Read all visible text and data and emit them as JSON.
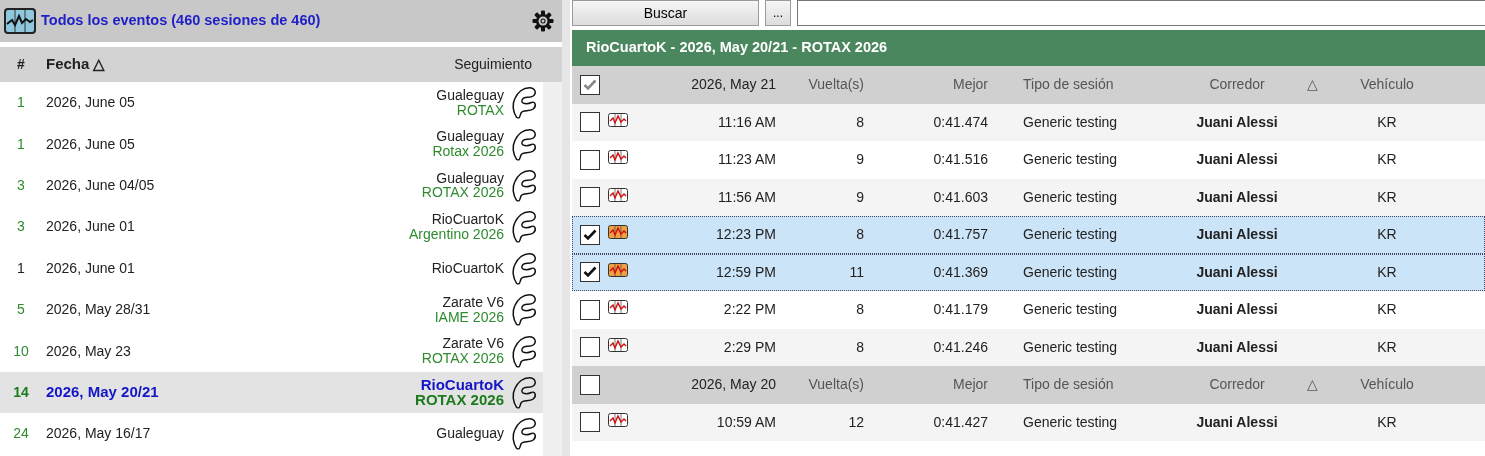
{
  "sidebar": {
    "title": "Todos los eventos (460 sesiones de 460)",
    "columns": [
      "#",
      "Fecha",
      "Seguimiento"
    ],
    "sort_mark": "△",
    "events": [
      {
        "count": "1",
        "date": "2026, June 05",
        "track": "Gualeguay",
        "series": "ROTAX",
        "color": "#2e8b2e",
        "selected": false
      },
      {
        "count": "1",
        "date": "2026, June 05",
        "track": "Gualeguay",
        "series": "Rotax 2026",
        "color": "#2e8b2e",
        "selected": false
      },
      {
        "count": "3",
        "date": "2026, June 04/05",
        "track": "Gualeguay",
        "series": "ROTAX 2026",
        "color": "#2e8b2e",
        "selected": false
      },
      {
        "count": "3",
        "date": "2026, June 01",
        "track": "RioCuartoK",
        "series": "Argentino 2026",
        "color": "#2e8b2e",
        "selected": false
      },
      {
        "count": "1",
        "date": "2026, June 01",
        "track": "RioCuartoK",
        "color": "#222222",
        "selected": false
      },
      {
        "count": "5",
        "date": "2026, May 28/31",
        "track": "Zarate V6",
        "series": "IAME 2026",
        "color": "#2e8b2e",
        "selected": false
      },
      {
        "count": "10",
        "date": "2026, May 23",
        "track": "Zarate V6",
        "series": "ROTAX 2026",
        "color": "#2e8b2e",
        "selected": false
      },
      {
        "count": "14",
        "date": "2026, May 20/21",
        "track": "RioCuartoK",
        "series": "ROTAX 2026",
        "color": "#1e7a1e",
        "selected": true
      },
      {
        "count": "24",
        "date": "2026, May 16/17",
        "track": "Gualeguay",
        "color": "#2e8b2e",
        "selected": false
      }
    ]
  },
  "search": {
    "button": "Buscar",
    "more_button": "..."
  },
  "event_title": "RioCuartoK - 2026, May 20/21 - ROTAX 2026",
  "groups": [
    {
      "date": "2026, May 21",
      "checked": true,
      "columns": [
        "Vuelta(s)",
        "Mejor",
        "Tipo de sesión",
        "Corredor",
        "Vehículo"
      ],
      "sort_mark": "△",
      "sessions": [
        {
          "time": "11:16 AM",
          "laps": "8",
          "best": "0:41.474",
          "type": "Generic testing",
          "driver": "Juani Alessi",
          "vehicle": "KR",
          "checked": false
        },
        {
          "time": "11:23 AM",
          "laps": "9",
          "best": "0:41.516",
          "type": "Generic testing",
          "driver": "Juani Alessi",
          "vehicle": "KR",
          "checked": false
        },
        {
          "time": "11:56 AM",
          "laps": "9",
          "best": "0:41.603",
          "type": "Generic testing",
          "driver": "Juani Alessi",
          "vehicle": "KR",
          "checked": false
        },
        {
          "time": "12:23 PM",
          "laps": "8",
          "best": "0:41.757",
          "type": "Generic testing",
          "driver": "Juani Alessi",
          "vehicle": "KR",
          "checked": true
        },
        {
          "time": "12:59 PM",
          "laps": "11",
          "best": "0:41.369",
          "type": "Generic testing",
          "driver": "Juani Alessi",
          "vehicle": "KR",
          "checked": true
        },
        {
          "time": "2:22 PM",
          "laps": "8",
          "best": "0:41.179",
          "type": "Generic testing",
          "driver": "Juani Alessi",
          "vehicle": "KR",
          "checked": false
        },
        {
          "time": "2:29 PM",
          "laps": "8",
          "best": "0:41.246",
          "type": "Generic testing",
          "driver": "Juani Alessi",
          "vehicle": "KR",
          "checked": false
        }
      ]
    },
    {
      "date": "2026, May 20",
      "checked": false,
      "columns": [
        "Vuelta(s)",
        "Mejor",
        "Tipo de sesión",
        "Corredor",
        "Vehículo"
      ],
      "sort_mark": "△",
      "sessions": [
        {
          "time": "10:59 AM",
          "laps": "12",
          "best": "0:41.427",
          "type": "Generic testing",
          "driver": "Juani Alessi",
          "vehicle": "KR",
          "checked": false
        }
      ]
    }
  ]
}
